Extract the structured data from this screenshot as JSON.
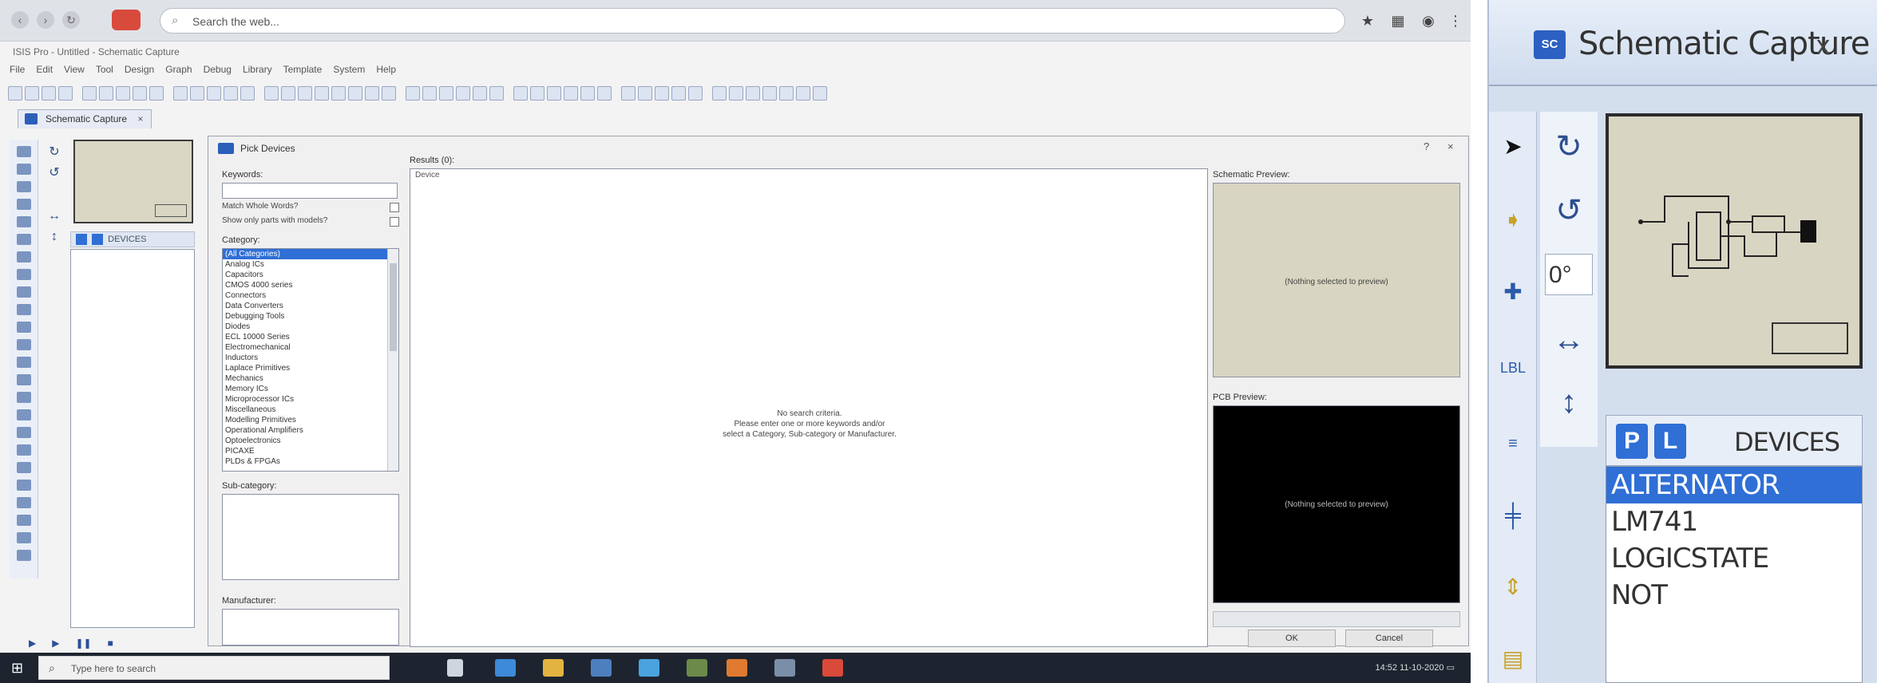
{
  "browser": {
    "address_text": "Search the web..."
  },
  "app": {
    "window_title": "ISIS Pro - Untitled - Schematic Capture",
    "menu": [
      "File",
      "Edit",
      "View",
      "Tool",
      "Design",
      "Graph",
      "Debug",
      "Library",
      "Template",
      "System",
      "Help"
    ],
    "doc_tab_label": "Schematic Capture",
    "pl_bar_label": "DEVICES"
  },
  "pick_devices": {
    "title": "Pick Devices",
    "keywords_label": "Keywords:",
    "match_whole_words": "Match Whole Words?",
    "show_only_parts": "Show only parts with models?",
    "category_label": "Category:",
    "categories": [
      "(All Categories)",
      "Analog ICs",
      "Capacitors",
      "CMOS 4000 series",
      "Connectors",
      "Data Converters",
      "Debugging Tools",
      "Diodes",
      "ECL 10000 Series",
      "Electromechanical",
      "Inductors",
      "Laplace Primitives",
      "Mechanics",
      "Memory ICs",
      "Microprocessor ICs",
      "Miscellaneous",
      "Modelling Primitives",
      "Operational Amplifiers",
      "Optoelectronics",
      "PICAXE",
      "PLDs & FPGAs"
    ],
    "sub_category_label": "Sub-category:",
    "manufacturer_label": "Manufacturer:",
    "results_label": "Results (0):",
    "results_sub": "Device",
    "results_message": [
      "No search criteria.",
      "Please enter one or more keywords and/or",
      "select a Category, Sub-category or Manufacturer."
    ],
    "schematic_preview_label": "Schematic Preview:",
    "pcb_preview_label": "PCB Preview:",
    "no_device_msg": "(Nothing selected to preview)",
    "ok_label": "OK",
    "cancel_label": "Cancel"
  },
  "taskbar": {
    "search_placeholder": "Type here to search",
    "time": "14:52",
    "date": "11-10-2020"
  },
  "zoom": {
    "tab_icon_text": "SC",
    "title": "Schematic Capture",
    "close": "x",
    "angle": "0°",
    "p_button": "P",
    "l_button": "L",
    "devices_label": "DEVICES",
    "devices": [
      "ALTERNATOR",
      "LM741",
      "LOGICSTATE",
      "NOT"
    ],
    "selected_device": "ALTERNATOR"
  },
  "colors": {
    "accent_blue": "#2f6fd6",
    "sheet_beige": "#d8d6c2",
    "taskbar": "#1d2430"
  }
}
